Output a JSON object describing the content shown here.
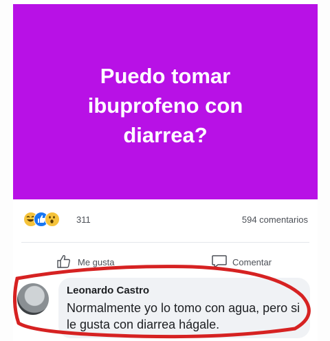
{
  "post": {
    "banner_text": "Puedo tomar ibuprofeno con diarrea?",
    "banner_color": "#b811e6"
  },
  "reactions": {
    "icons": [
      "haha-emoji-icon",
      "like-reaction-icon",
      "wow-emoji-icon"
    ],
    "count": "311",
    "comments_count": "594 comentarios"
  },
  "actions": {
    "like_label": "Me gusta",
    "comment_label": "Comentar"
  },
  "comment": {
    "author": "Leonardo Castro",
    "text": "Normalmente yo lo tomo con agua, pero si le gusta con diarrea hágale."
  },
  "colors": {
    "highlight_circle": "#d62222",
    "like_blue": "#1877f2"
  }
}
